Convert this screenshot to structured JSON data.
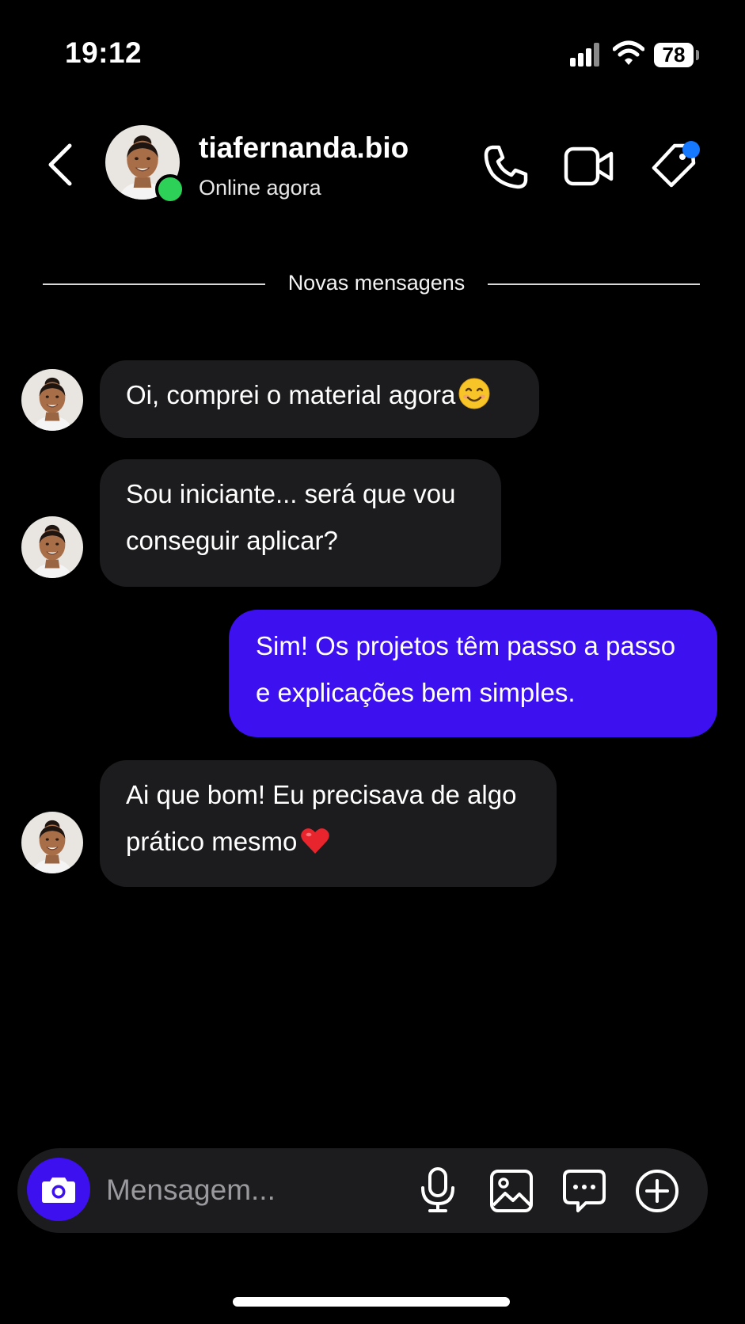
{
  "status_bar": {
    "time": "19:12",
    "battery": "78",
    "icons": [
      "signal-icon",
      "wifi-icon",
      "battery-icon"
    ]
  },
  "header": {
    "contact_name": "tiafernanda.bio",
    "status": "Online agora",
    "icons": [
      "back-icon",
      "phone-icon",
      "video-camera-icon",
      "tag-icon"
    ],
    "online_color": "#2ed158",
    "badge_color": "#1677ff"
  },
  "divider": {
    "label": "Novas mensagens"
  },
  "messages": [
    {
      "direction": "incoming",
      "lines": [
        "Oi, comprei o material agora"
      ],
      "emoji": "smiling-face"
    },
    {
      "direction": "incoming",
      "lines": [
        "Sou iniciante... será que vou",
        "conseguir aplicar?"
      ]
    },
    {
      "direction": "outgoing",
      "lines": [
        "Sim! Os projetos têm passo a passo",
        "e explicações bem simples."
      ]
    },
    {
      "direction": "incoming",
      "lines": [
        "Ai que bom! Eu precisava de algo",
        "prático mesmo"
      ],
      "emoji": "red-heart"
    }
  ],
  "composer": {
    "placeholder": "Mensagem...",
    "icons": [
      "camera-icon",
      "microphone-icon",
      "image-icon",
      "chat-bubble-icon",
      "plus-circle-icon"
    ]
  },
  "colors": {
    "background": "#000000",
    "incoming_bubble": "#1c1c1e",
    "outgoing_bubble": "#3d10f0",
    "accent": "#3d10f0"
  }
}
